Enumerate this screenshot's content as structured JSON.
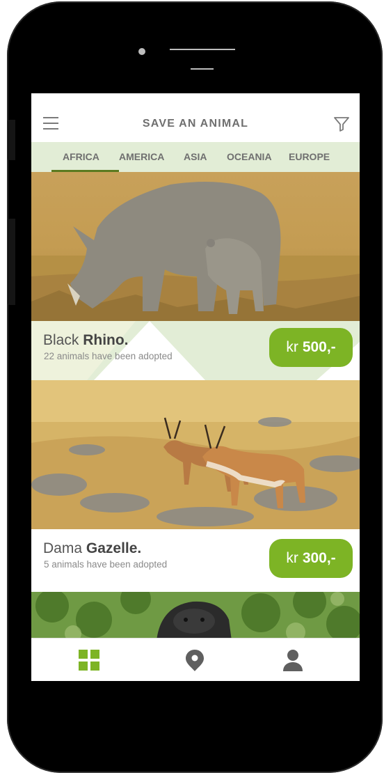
{
  "header": {
    "title": "SAVE AN ANIMAL",
    "menu_icon": "hamburger-menu-icon",
    "filter_icon": "filter-funnel-icon"
  },
  "tabs": [
    {
      "label": "AFRICA",
      "active": true
    },
    {
      "label": "AMERICA"
    },
    {
      "label": "ASIA"
    },
    {
      "label": "OCEANIA"
    },
    {
      "label": "EUROPE"
    }
  ],
  "animals": [
    {
      "name_prefix": "Black",
      "name_bold": "Rhino.",
      "adopted": "22 animals have been adopted",
      "price_prefix": "kr",
      "price_value": "500,-"
    },
    {
      "name_prefix": "Dama",
      "name_bold": "Gazelle.",
      "adopted": "5 animals have been adopted",
      "price_prefix": "kr",
      "price_value": "300,-"
    }
  ],
  "bottom_nav": [
    {
      "icon": "grid-icon",
      "active": true
    },
    {
      "icon": "location-pin-icon"
    },
    {
      "icon": "user-profile-icon"
    }
  ],
  "colors": {
    "accent": "#7db425",
    "tab_bg": "#e2edd6",
    "tab_underline": "#5b7a20",
    "text": "#6f6f6f"
  }
}
